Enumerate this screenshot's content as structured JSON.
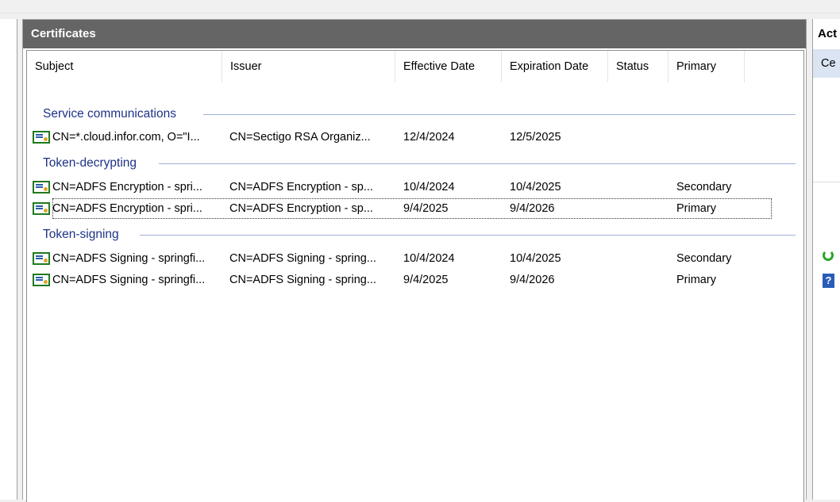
{
  "window": {
    "pane_title": "Certificates"
  },
  "columns": [
    "Subject",
    "Issuer",
    "Effective Date",
    "Expiration Date",
    "Status",
    "Primary"
  ],
  "groups": [
    {
      "name": "Service communications",
      "rows": [
        {
          "subject": "CN=*.cloud.infor.com, O=\"I...",
          "issuer": "CN=Sectigo RSA Organiz...",
          "effective": "12/4/2024",
          "expiration": "12/5/2025",
          "status": "",
          "primary": ""
        }
      ]
    },
    {
      "name": "Token-decrypting",
      "rows": [
        {
          "subject": "CN=ADFS Encryption - spri...",
          "issuer": "CN=ADFS Encryption - sp...",
          "effective": "10/4/2024",
          "expiration": "10/4/2025",
          "status": "",
          "primary": "Secondary"
        },
        {
          "subject": "CN=ADFS Encryption - spri...",
          "issuer": "CN=ADFS Encryption - sp...",
          "effective": "9/4/2025",
          "expiration": "9/4/2026",
          "status": "",
          "primary": "Primary"
        }
      ]
    },
    {
      "name": "Token-signing",
      "rows": [
        {
          "subject": "CN=ADFS Signing - springfi...",
          "issuer": "CN=ADFS Signing - spring...",
          "effective": "10/4/2024",
          "expiration": "10/4/2025",
          "status": "",
          "primary": "Secondary"
        },
        {
          "subject": "CN=ADFS Signing - springfi...",
          "issuer": "CN=ADFS Signing - spring...",
          "effective": "9/4/2025",
          "expiration": "9/4/2026",
          "status": "",
          "primary": "Primary"
        }
      ]
    }
  ],
  "actions": {
    "title": "Act",
    "subheader": "Ce"
  },
  "icons": {
    "certificate": "certificate-icon",
    "refresh": "refresh-icon",
    "help": "help-icon"
  },
  "colors": {
    "pane_header_bg": "#656565",
    "group_text": "#1e3287",
    "group_line": "#9fb1d6",
    "actions_sub_bg": "#dbe4f2"
  }
}
